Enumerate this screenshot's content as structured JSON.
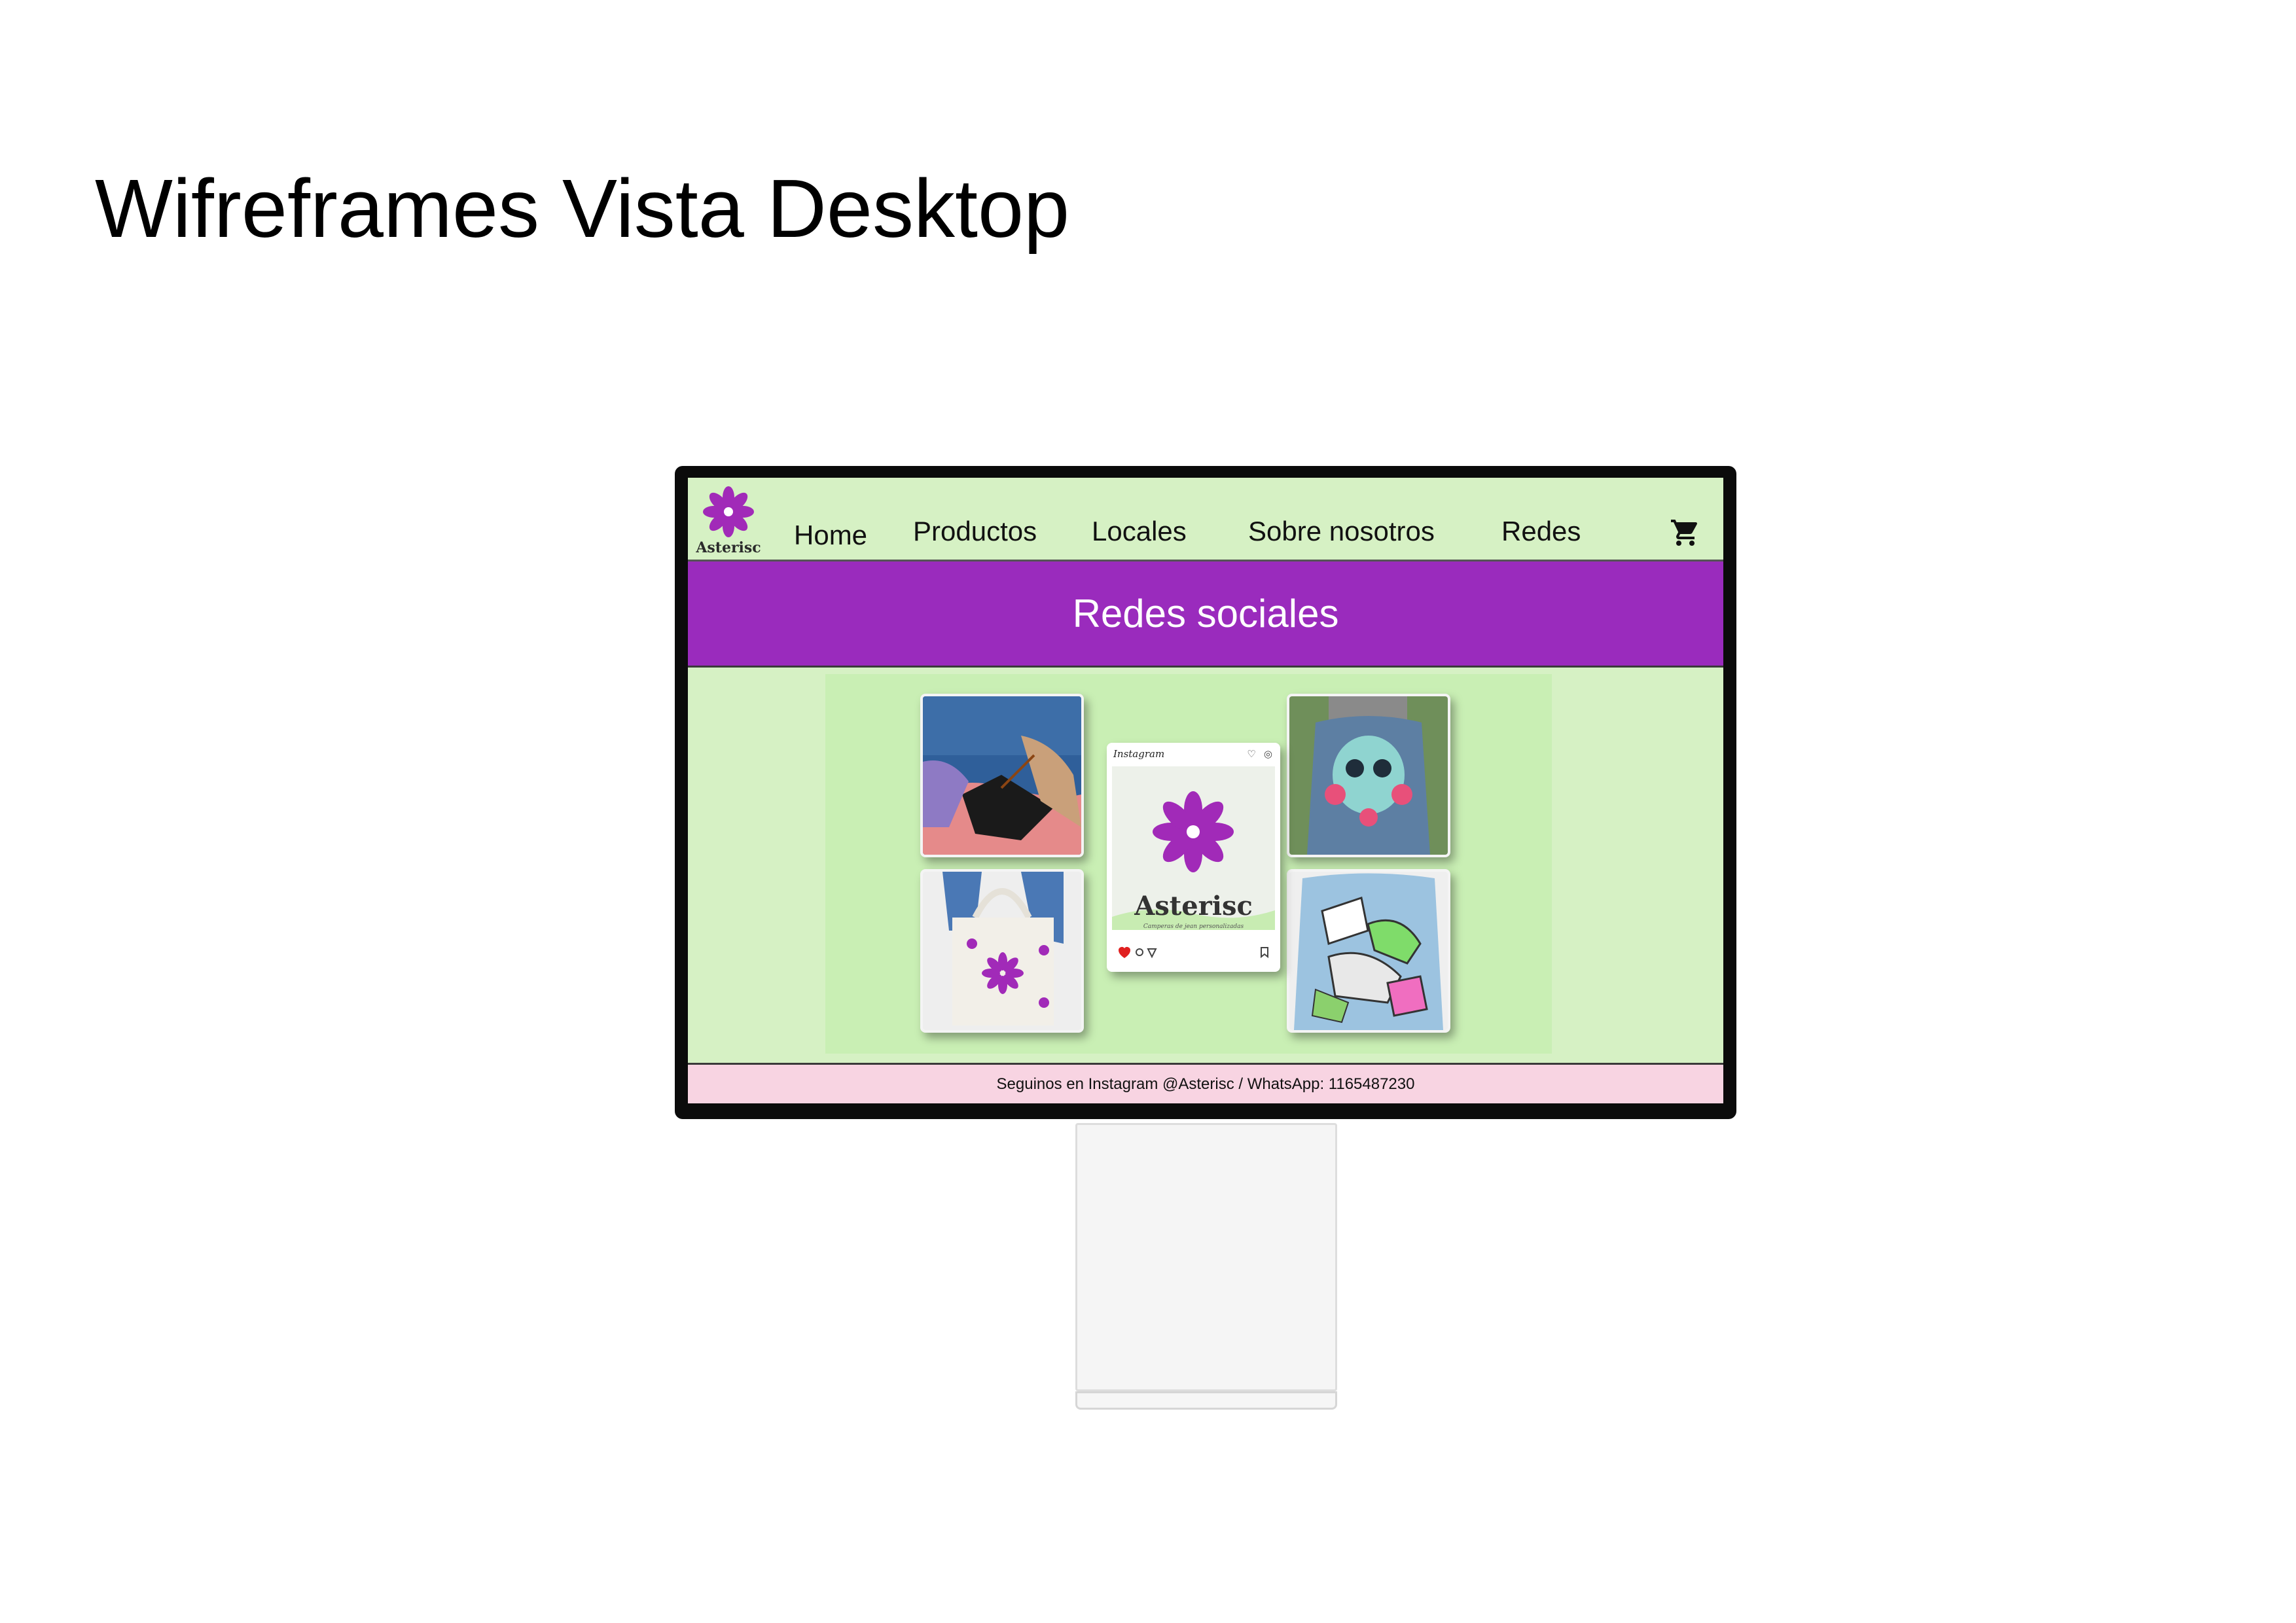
{
  "slide": {
    "title": "Wifreframes Vista Desktop"
  },
  "navbar": {
    "logo_text": "Asterisc",
    "items": [
      {
        "label": "Home"
      },
      {
        "label": "Productos"
      },
      {
        "label": "Locales"
      },
      {
        "label": "Sobre nosotros"
      },
      {
        "label": "Redes"
      }
    ],
    "cart_icon": "shopping-cart-icon"
  },
  "banner": {
    "title": "Redes sociales"
  },
  "collage": {
    "instagram_header": "Instagram",
    "brand": "Asterisc",
    "brand_subtitle": "Camperas de jean personalizadas"
  },
  "footer": {
    "text": "Seguinos en Instagram @Asterisc / WhatsApp: 1165487230"
  },
  "colors": {
    "screen_bg": "#d6f1c4",
    "banner_bg": "#9a2bbd",
    "footer_bg": "#f8d4e2",
    "brand_purple": "#a12ab8"
  }
}
